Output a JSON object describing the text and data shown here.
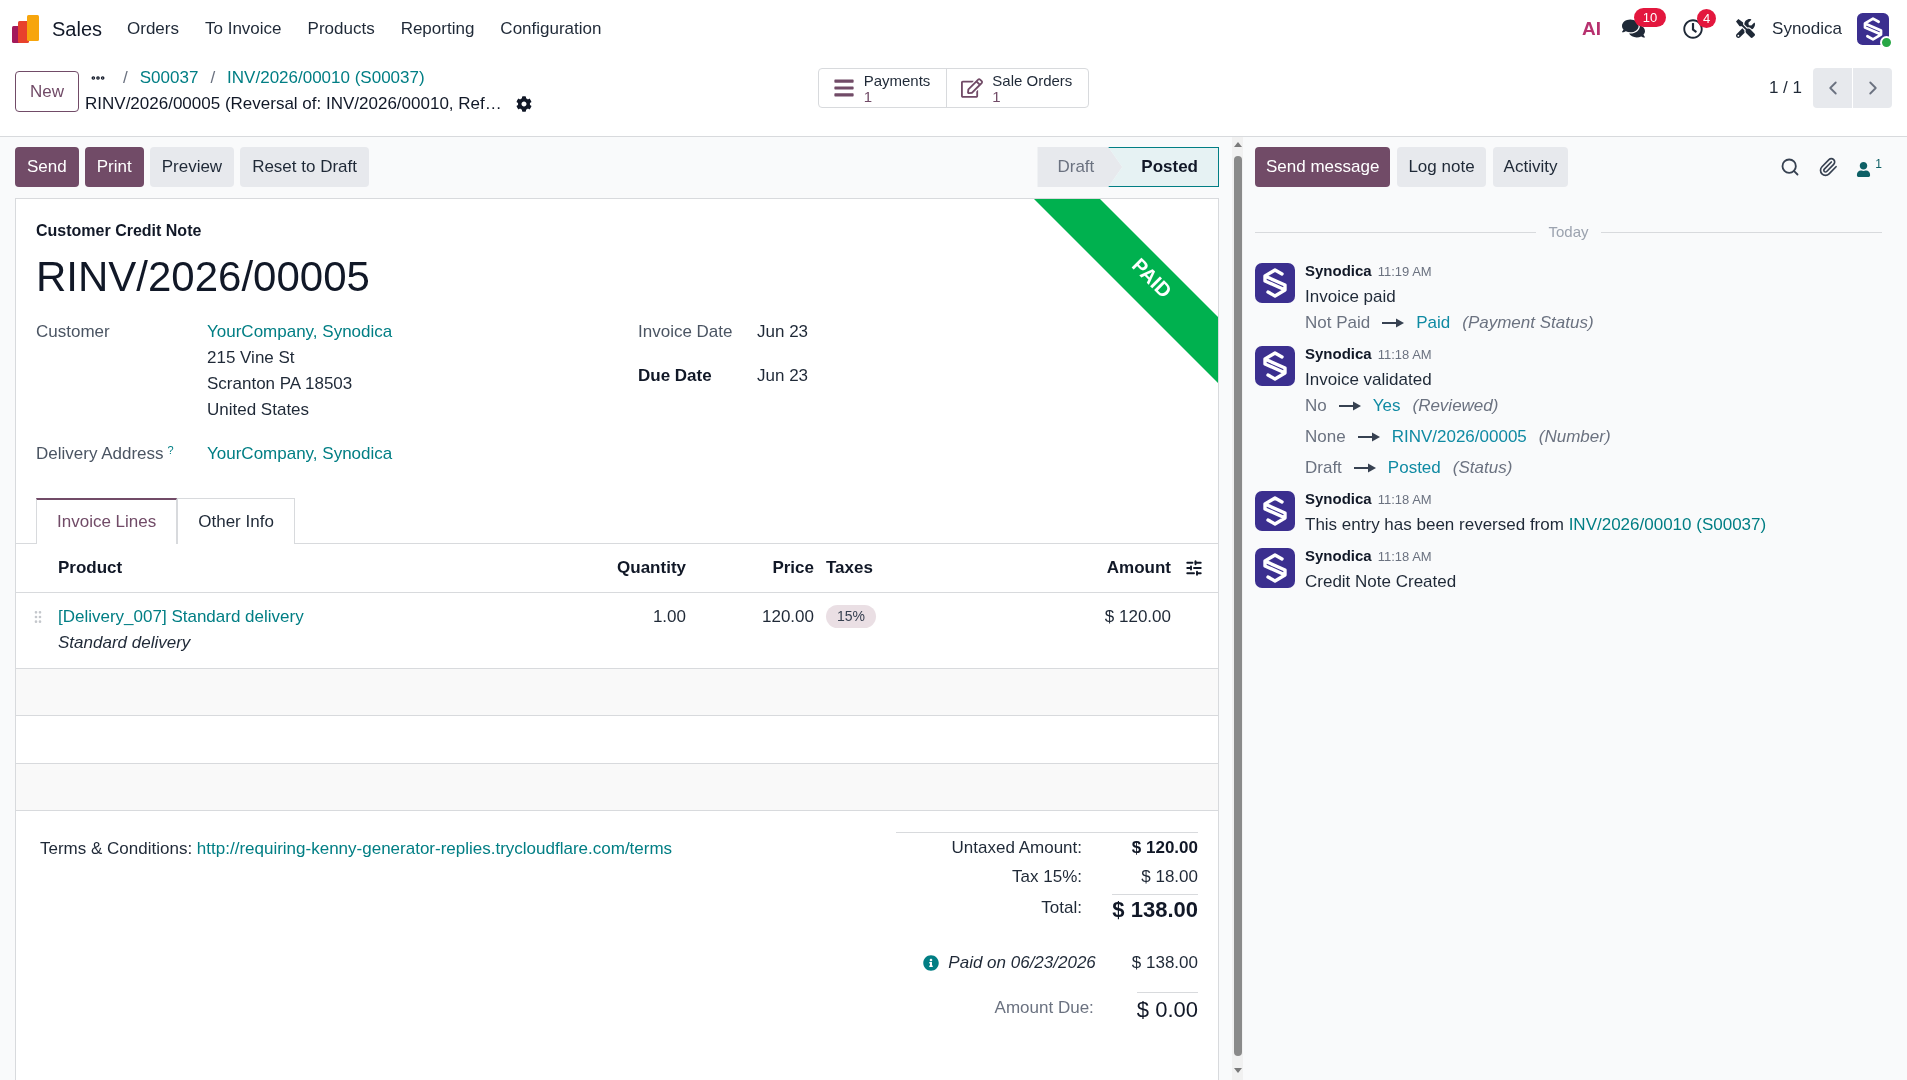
{
  "navbar": {
    "app": "Sales",
    "menu": [
      "Orders",
      "To Invoice",
      "Products",
      "Reporting",
      "Configuration"
    ],
    "ai": "AI",
    "messages_count": "10",
    "activities_count": "4",
    "user": {
      "name": "Synodica",
      "online": true
    }
  },
  "control_panel": {
    "new_button": "New",
    "breadcrumbs": [
      {
        "separator": "/",
        "label": "S00037"
      },
      {
        "separator": "/",
        "label": "INV/2026/00010 (S00037)"
      }
    ],
    "record_name": "RINV/2026/00005 (Reversal of: INV/2026/00010, Ref…",
    "smart_buttons": [
      {
        "kind": "payments",
        "label": "Payments",
        "count": "1"
      },
      {
        "kind": "orders",
        "label": "Sale Orders",
        "count": "1"
      }
    ],
    "pager": "1 / 1"
  },
  "actions": [
    {
      "label": "Send",
      "kind": "primary"
    },
    {
      "label": "Print",
      "kind": "primary"
    },
    {
      "label": "Preview",
      "kind": "secondary"
    },
    {
      "label": "Reset to Draft",
      "kind": "secondary"
    }
  ],
  "status_bar": [
    {
      "label": "Draft",
      "selected": false
    },
    {
      "label": "Posted",
      "selected": true
    }
  ],
  "document": {
    "ribbon": "PAID",
    "type_label": "Customer Credit Note",
    "number": "RINV/2026/00005",
    "fields_left": [
      {
        "label": "Customer",
        "kind": "link",
        "emphasized": false,
        "value": "YourCompany, Synodica",
        "lines": [
          "215 Vine St",
          "Scranton PA 18503",
          "United States"
        ]
      },
      {
        "label": "Delivery Address",
        "help": "?",
        "kind": "link",
        "emphasized": false,
        "value": "YourCompany, Synodica"
      }
    ],
    "fields_right": [
      {
        "label": "Invoice Date",
        "kind": "text",
        "emphasized": false,
        "value": "Jun 23"
      },
      {
        "label": "Due Date",
        "kind": "text",
        "emphasized": true,
        "value": "Jun 23"
      }
    ],
    "tabs": [
      {
        "label": "Invoice Lines",
        "selected": true
      },
      {
        "label": "Other Info",
        "selected": false
      }
    ],
    "table": {
      "columns": [
        "Product",
        "Quantity",
        "Price",
        "Taxes",
        "Amount"
      ],
      "rows": [
        {
          "product": "[Delivery_007] Standard delivery",
          "description": "Standard delivery",
          "quantity": "1.00",
          "price": "120.00",
          "taxes": [
            "15%"
          ],
          "amount": "$ 120.00"
        }
      ]
    },
    "terms": {
      "label": "Terms & Conditions:",
      "link": "http://requiring-kenny-generator-replies.trycloudflare.com/terms"
    },
    "totals": [
      {
        "kind": "subtotal",
        "label": "Untaxed Amount:",
        "value": "$ 120.00"
      },
      {
        "kind": "tax",
        "label": "Tax 15%:",
        "value": "$ 18.00"
      },
      {
        "kind": "total",
        "label": "Total:",
        "value": "$ 138.00"
      }
    ],
    "payments": [
      {
        "label": "Paid on 06/23/2026",
        "amount": "$ 138.00"
      }
    ],
    "amount_due": {
      "label": "Amount Due:",
      "value": "$ 0.00"
    }
  },
  "chatter": {
    "buttons": [
      {
        "label": "Send message",
        "kind": "primary"
      },
      {
        "label": "Log note",
        "kind": "secondary"
      },
      {
        "label": "Activity",
        "kind": "secondary"
      }
    ],
    "followers_count": "1",
    "date_separator": "Today",
    "messages": [
      {
        "author": "Synodica",
        "time": "11:19 AM",
        "body": "Invoice paid",
        "tracking": [
          {
            "old": "Not Paid",
            "new": "Paid",
            "field": "(Payment Status)"
          }
        ]
      },
      {
        "author": "Synodica",
        "time": "11:18 AM",
        "body": "Invoice validated",
        "tracking": [
          {
            "old": "No",
            "new": "Yes",
            "field": "(Reviewed)"
          },
          {
            "old": "None",
            "new": "RINV/2026/00005",
            "field": "(Number)"
          },
          {
            "old": "Draft",
            "new": "Posted",
            "field": "(Status)"
          }
        ]
      },
      {
        "author": "Synodica",
        "time": "11:18 AM",
        "body": "This entry has been reversed from",
        "link": "INV/2026/00010 (S00037)"
      },
      {
        "author": "Synodica",
        "time": "11:18 AM",
        "body": "Credit Note Created"
      }
    ]
  }
}
